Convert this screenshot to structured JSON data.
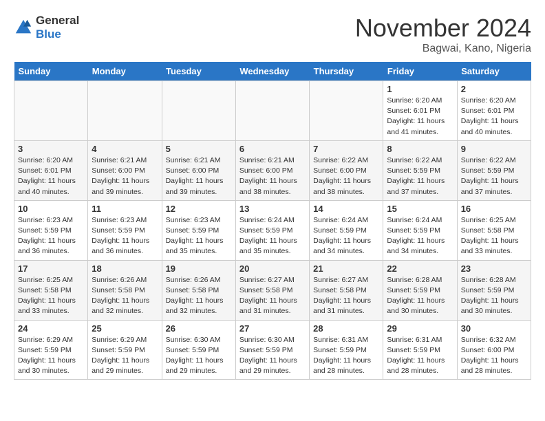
{
  "logo": {
    "general": "General",
    "blue": "Blue"
  },
  "title": "November 2024",
  "location": "Bagwai, Kano, Nigeria",
  "days_of_week": [
    "Sunday",
    "Monday",
    "Tuesday",
    "Wednesday",
    "Thursday",
    "Friday",
    "Saturday"
  ],
  "weeks": [
    {
      "days": [
        {
          "num": "",
          "info": ""
        },
        {
          "num": "",
          "info": ""
        },
        {
          "num": "",
          "info": ""
        },
        {
          "num": "",
          "info": ""
        },
        {
          "num": "",
          "info": ""
        },
        {
          "num": "1",
          "info": "Sunrise: 6:20 AM\nSunset: 6:01 PM\nDaylight: 11 hours\nand 41 minutes."
        },
        {
          "num": "2",
          "info": "Sunrise: 6:20 AM\nSunset: 6:01 PM\nDaylight: 11 hours\nand 40 minutes."
        }
      ]
    },
    {
      "days": [
        {
          "num": "3",
          "info": "Sunrise: 6:20 AM\nSunset: 6:01 PM\nDaylight: 11 hours\nand 40 minutes."
        },
        {
          "num": "4",
          "info": "Sunrise: 6:21 AM\nSunset: 6:00 PM\nDaylight: 11 hours\nand 39 minutes."
        },
        {
          "num": "5",
          "info": "Sunrise: 6:21 AM\nSunset: 6:00 PM\nDaylight: 11 hours\nand 39 minutes."
        },
        {
          "num": "6",
          "info": "Sunrise: 6:21 AM\nSunset: 6:00 PM\nDaylight: 11 hours\nand 38 minutes."
        },
        {
          "num": "7",
          "info": "Sunrise: 6:22 AM\nSunset: 6:00 PM\nDaylight: 11 hours\nand 38 minutes."
        },
        {
          "num": "8",
          "info": "Sunrise: 6:22 AM\nSunset: 5:59 PM\nDaylight: 11 hours\nand 37 minutes."
        },
        {
          "num": "9",
          "info": "Sunrise: 6:22 AM\nSunset: 5:59 PM\nDaylight: 11 hours\nand 37 minutes."
        }
      ]
    },
    {
      "days": [
        {
          "num": "10",
          "info": "Sunrise: 6:23 AM\nSunset: 5:59 PM\nDaylight: 11 hours\nand 36 minutes."
        },
        {
          "num": "11",
          "info": "Sunrise: 6:23 AM\nSunset: 5:59 PM\nDaylight: 11 hours\nand 36 minutes."
        },
        {
          "num": "12",
          "info": "Sunrise: 6:23 AM\nSunset: 5:59 PM\nDaylight: 11 hours\nand 35 minutes."
        },
        {
          "num": "13",
          "info": "Sunrise: 6:24 AM\nSunset: 5:59 PM\nDaylight: 11 hours\nand 35 minutes."
        },
        {
          "num": "14",
          "info": "Sunrise: 6:24 AM\nSunset: 5:59 PM\nDaylight: 11 hours\nand 34 minutes."
        },
        {
          "num": "15",
          "info": "Sunrise: 6:24 AM\nSunset: 5:59 PM\nDaylight: 11 hours\nand 34 minutes."
        },
        {
          "num": "16",
          "info": "Sunrise: 6:25 AM\nSunset: 5:58 PM\nDaylight: 11 hours\nand 33 minutes."
        }
      ]
    },
    {
      "days": [
        {
          "num": "17",
          "info": "Sunrise: 6:25 AM\nSunset: 5:58 PM\nDaylight: 11 hours\nand 33 minutes."
        },
        {
          "num": "18",
          "info": "Sunrise: 6:26 AM\nSunset: 5:58 PM\nDaylight: 11 hours\nand 32 minutes."
        },
        {
          "num": "19",
          "info": "Sunrise: 6:26 AM\nSunset: 5:58 PM\nDaylight: 11 hours\nand 32 minutes."
        },
        {
          "num": "20",
          "info": "Sunrise: 6:27 AM\nSunset: 5:58 PM\nDaylight: 11 hours\nand 31 minutes."
        },
        {
          "num": "21",
          "info": "Sunrise: 6:27 AM\nSunset: 5:58 PM\nDaylight: 11 hours\nand 31 minutes."
        },
        {
          "num": "22",
          "info": "Sunrise: 6:28 AM\nSunset: 5:59 PM\nDaylight: 11 hours\nand 30 minutes."
        },
        {
          "num": "23",
          "info": "Sunrise: 6:28 AM\nSunset: 5:59 PM\nDaylight: 11 hours\nand 30 minutes."
        }
      ]
    },
    {
      "days": [
        {
          "num": "24",
          "info": "Sunrise: 6:29 AM\nSunset: 5:59 PM\nDaylight: 11 hours\nand 30 minutes."
        },
        {
          "num": "25",
          "info": "Sunrise: 6:29 AM\nSunset: 5:59 PM\nDaylight: 11 hours\nand 29 minutes."
        },
        {
          "num": "26",
          "info": "Sunrise: 6:30 AM\nSunset: 5:59 PM\nDaylight: 11 hours\nand 29 minutes."
        },
        {
          "num": "27",
          "info": "Sunrise: 6:30 AM\nSunset: 5:59 PM\nDaylight: 11 hours\nand 29 minutes."
        },
        {
          "num": "28",
          "info": "Sunrise: 6:31 AM\nSunset: 5:59 PM\nDaylight: 11 hours\nand 28 minutes."
        },
        {
          "num": "29",
          "info": "Sunrise: 6:31 AM\nSunset: 5:59 PM\nDaylight: 11 hours\nand 28 minutes."
        },
        {
          "num": "30",
          "info": "Sunrise: 6:32 AM\nSunset: 6:00 PM\nDaylight: 11 hours\nand 28 minutes."
        }
      ]
    }
  ]
}
